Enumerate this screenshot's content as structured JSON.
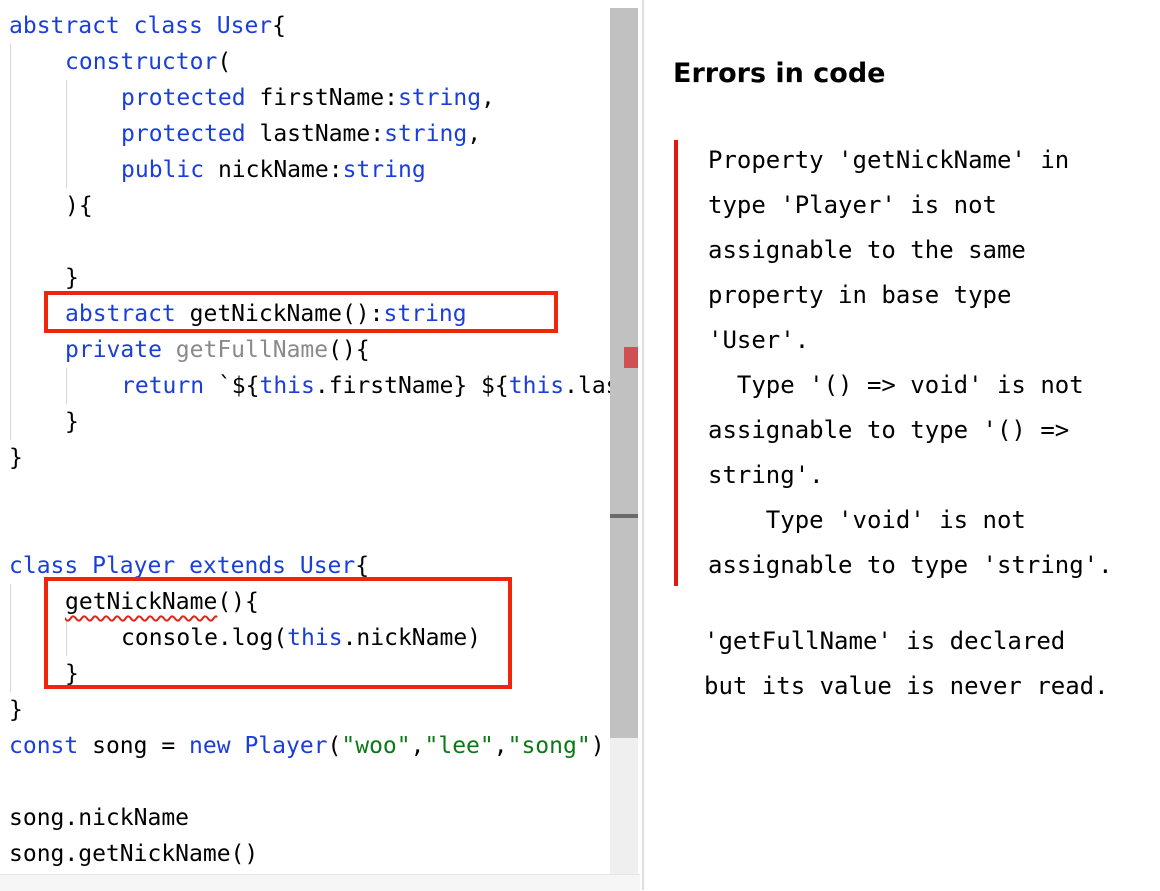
{
  "code": {
    "l1": {
      "kw1": "abstract",
      "kw2": "class",
      "name": "User",
      "rest": "{"
    },
    "l2": {
      "kw": "constructor",
      "rest": "("
    },
    "l3": {
      "kw": "protected",
      "name": " firstName:",
      "type": "string",
      "rest": ","
    },
    "l4": {
      "kw": "protected",
      "name": " lastName:",
      "type": "string",
      "rest": ","
    },
    "l5": {
      "kw": "public",
      "name": " nickName:",
      "type": "string"
    },
    "l6": {
      "text": "){"
    },
    "l8": {
      "text": "}"
    },
    "l9": {
      "kw": "abstract",
      "name": " getNickName():",
      "type": "string"
    },
    "l10": {
      "kw": "private",
      "name": "getFullName",
      "rest": "(){"
    },
    "l11": {
      "kw": "return",
      "p1": " `${",
      "this1": "this",
      "p2": ".firstName} ${",
      "this2": "this",
      "p3": ".last"
    },
    "l12": {
      "text": "}"
    },
    "l13": {
      "text": "}"
    },
    "l16": {
      "kw1": "class",
      "name": "Player",
      "kw2": "extends",
      "base": "User",
      "rest": "{"
    },
    "l17": {
      "name": "getNickName",
      "rest": "(){"
    },
    "l18": {
      "p1": "console.log(",
      "this": "this",
      "p2": ".nickName)"
    },
    "l19": {
      "text": "}"
    },
    "l20": {
      "text": "}"
    },
    "l21": {
      "kw": "const",
      "p1": " song = ",
      "kw2": "new",
      "cls": "Player",
      "p2": "(",
      "s1": "\"woo\"",
      "c1": ",",
      "s2": "\"lee\"",
      "c2": ",",
      "s3": "\"song\"",
      "p3": ")"
    },
    "l23": {
      "text": "song.nickName"
    },
    "l24": {
      "text": "song.getNickName()"
    }
  },
  "panel": {
    "title": "Errors in code",
    "error": "Property 'getNickName' in\ntype 'Player' is not\nassignable to the same\nproperty in base type\n'User'.\n  Type '() => void' is not\nassignable to type '() =>\nstring'.\n    Type 'void' is not\nassignable to type 'string'.",
    "warning": "'getFullName' is declared\nbut its value is never read."
  },
  "colors": {
    "keyword": "#1a3edb",
    "string": "#0a7a17",
    "highlight": "#f0260c",
    "error_bar": "#e2190c"
  }
}
